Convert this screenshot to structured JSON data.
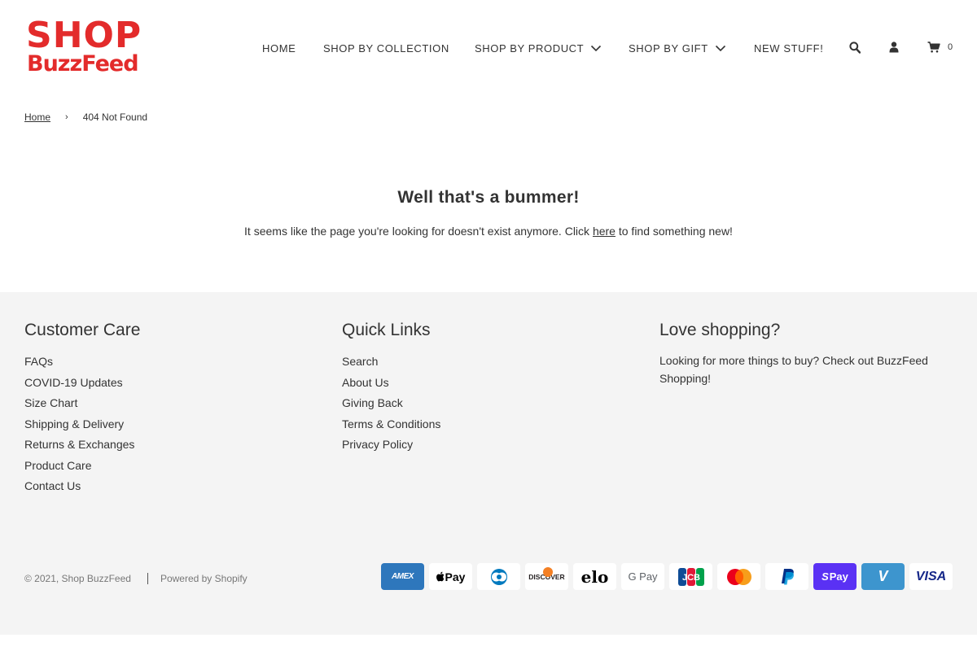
{
  "brand": {
    "logo_top": "SHOP",
    "logo_bottom": "BuzzFeed",
    "color": "#e32b2b"
  },
  "nav": {
    "home": "HOME",
    "collection": "SHOP BY COLLECTION",
    "product": "SHOP BY PRODUCT",
    "gift": "SHOP BY GIFT",
    "new": "NEW STUFF!",
    "cart_count": "0"
  },
  "breadcrumb": {
    "home": "Home",
    "separator": "›",
    "current": "404 Not Found"
  },
  "main": {
    "title": "Well that's a bummer!",
    "text_before": "It seems like the page you're looking for doesn't exist anymore. Click ",
    "link": "here",
    "text_after": " to find something new!"
  },
  "footer": {
    "customer_care": {
      "title": "Customer Care",
      "items": [
        "FAQs",
        "COVID-19 Updates",
        "Size Chart",
        "Shipping & Delivery",
        "Returns & Exchanges",
        "Product Care",
        "Contact Us"
      ]
    },
    "quick_links": {
      "title": "Quick Links",
      "items": [
        "Search",
        "About Us",
        "Giving Back",
        "Terms & Conditions",
        "Privacy Policy"
      ]
    },
    "love_shopping": {
      "title": "Love shopping?",
      "text": "Looking for more things to buy? Check out BuzzFeed Shopping!"
    },
    "copyright": "© 2021, Shop BuzzFeed",
    "powered": "Powered by Shopify",
    "payments": [
      {
        "icon": "amex-icon",
        "label": "AMEX",
        "bg": "#2e77bc",
        "fg": "#ffffff"
      },
      {
        "icon": "apple-pay-icon",
        "label": " Pay",
        "bg": "#ffffff",
        "fg": "#000000"
      },
      {
        "icon": "diners-club-icon",
        "label": "◎",
        "bg": "#ffffff",
        "fg": "#0079be"
      },
      {
        "icon": "discover-icon",
        "label": "DISCOVER",
        "bg": "#ffffff",
        "fg": "#231f20"
      },
      {
        "icon": "elo-icon",
        "label": "elo",
        "bg": "#ffffff",
        "fg": "#000000"
      },
      {
        "icon": "google-pay-icon",
        "label": "G Pay",
        "bg": "#ffffff",
        "fg": "#5f6368"
      },
      {
        "icon": "jcb-icon",
        "label": "JCB",
        "bg": "#ffffff",
        "fg": "#0b8b3c"
      },
      {
        "icon": "mastercard-icon",
        "label": "",
        "bg": "#ffffff",
        "fg": "#eb001b"
      },
      {
        "icon": "paypal-icon",
        "label": "PayPal",
        "bg": "#ffffff",
        "fg": "#003087"
      },
      {
        "icon": "shop-pay-icon",
        "label": "Pay",
        "bg": "#5a31f4",
        "fg": "#ffffff"
      },
      {
        "icon": "venmo-icon",
        "label": "V",
        "bg": "#3d95ce",
        "fg": "#ffffff"
      },
      {
        "icon": "visa-icon",
        "label": "VISA",
        "bg": "#ffffff",
        "fg": "#142688"
      }
    ]
  }
}
